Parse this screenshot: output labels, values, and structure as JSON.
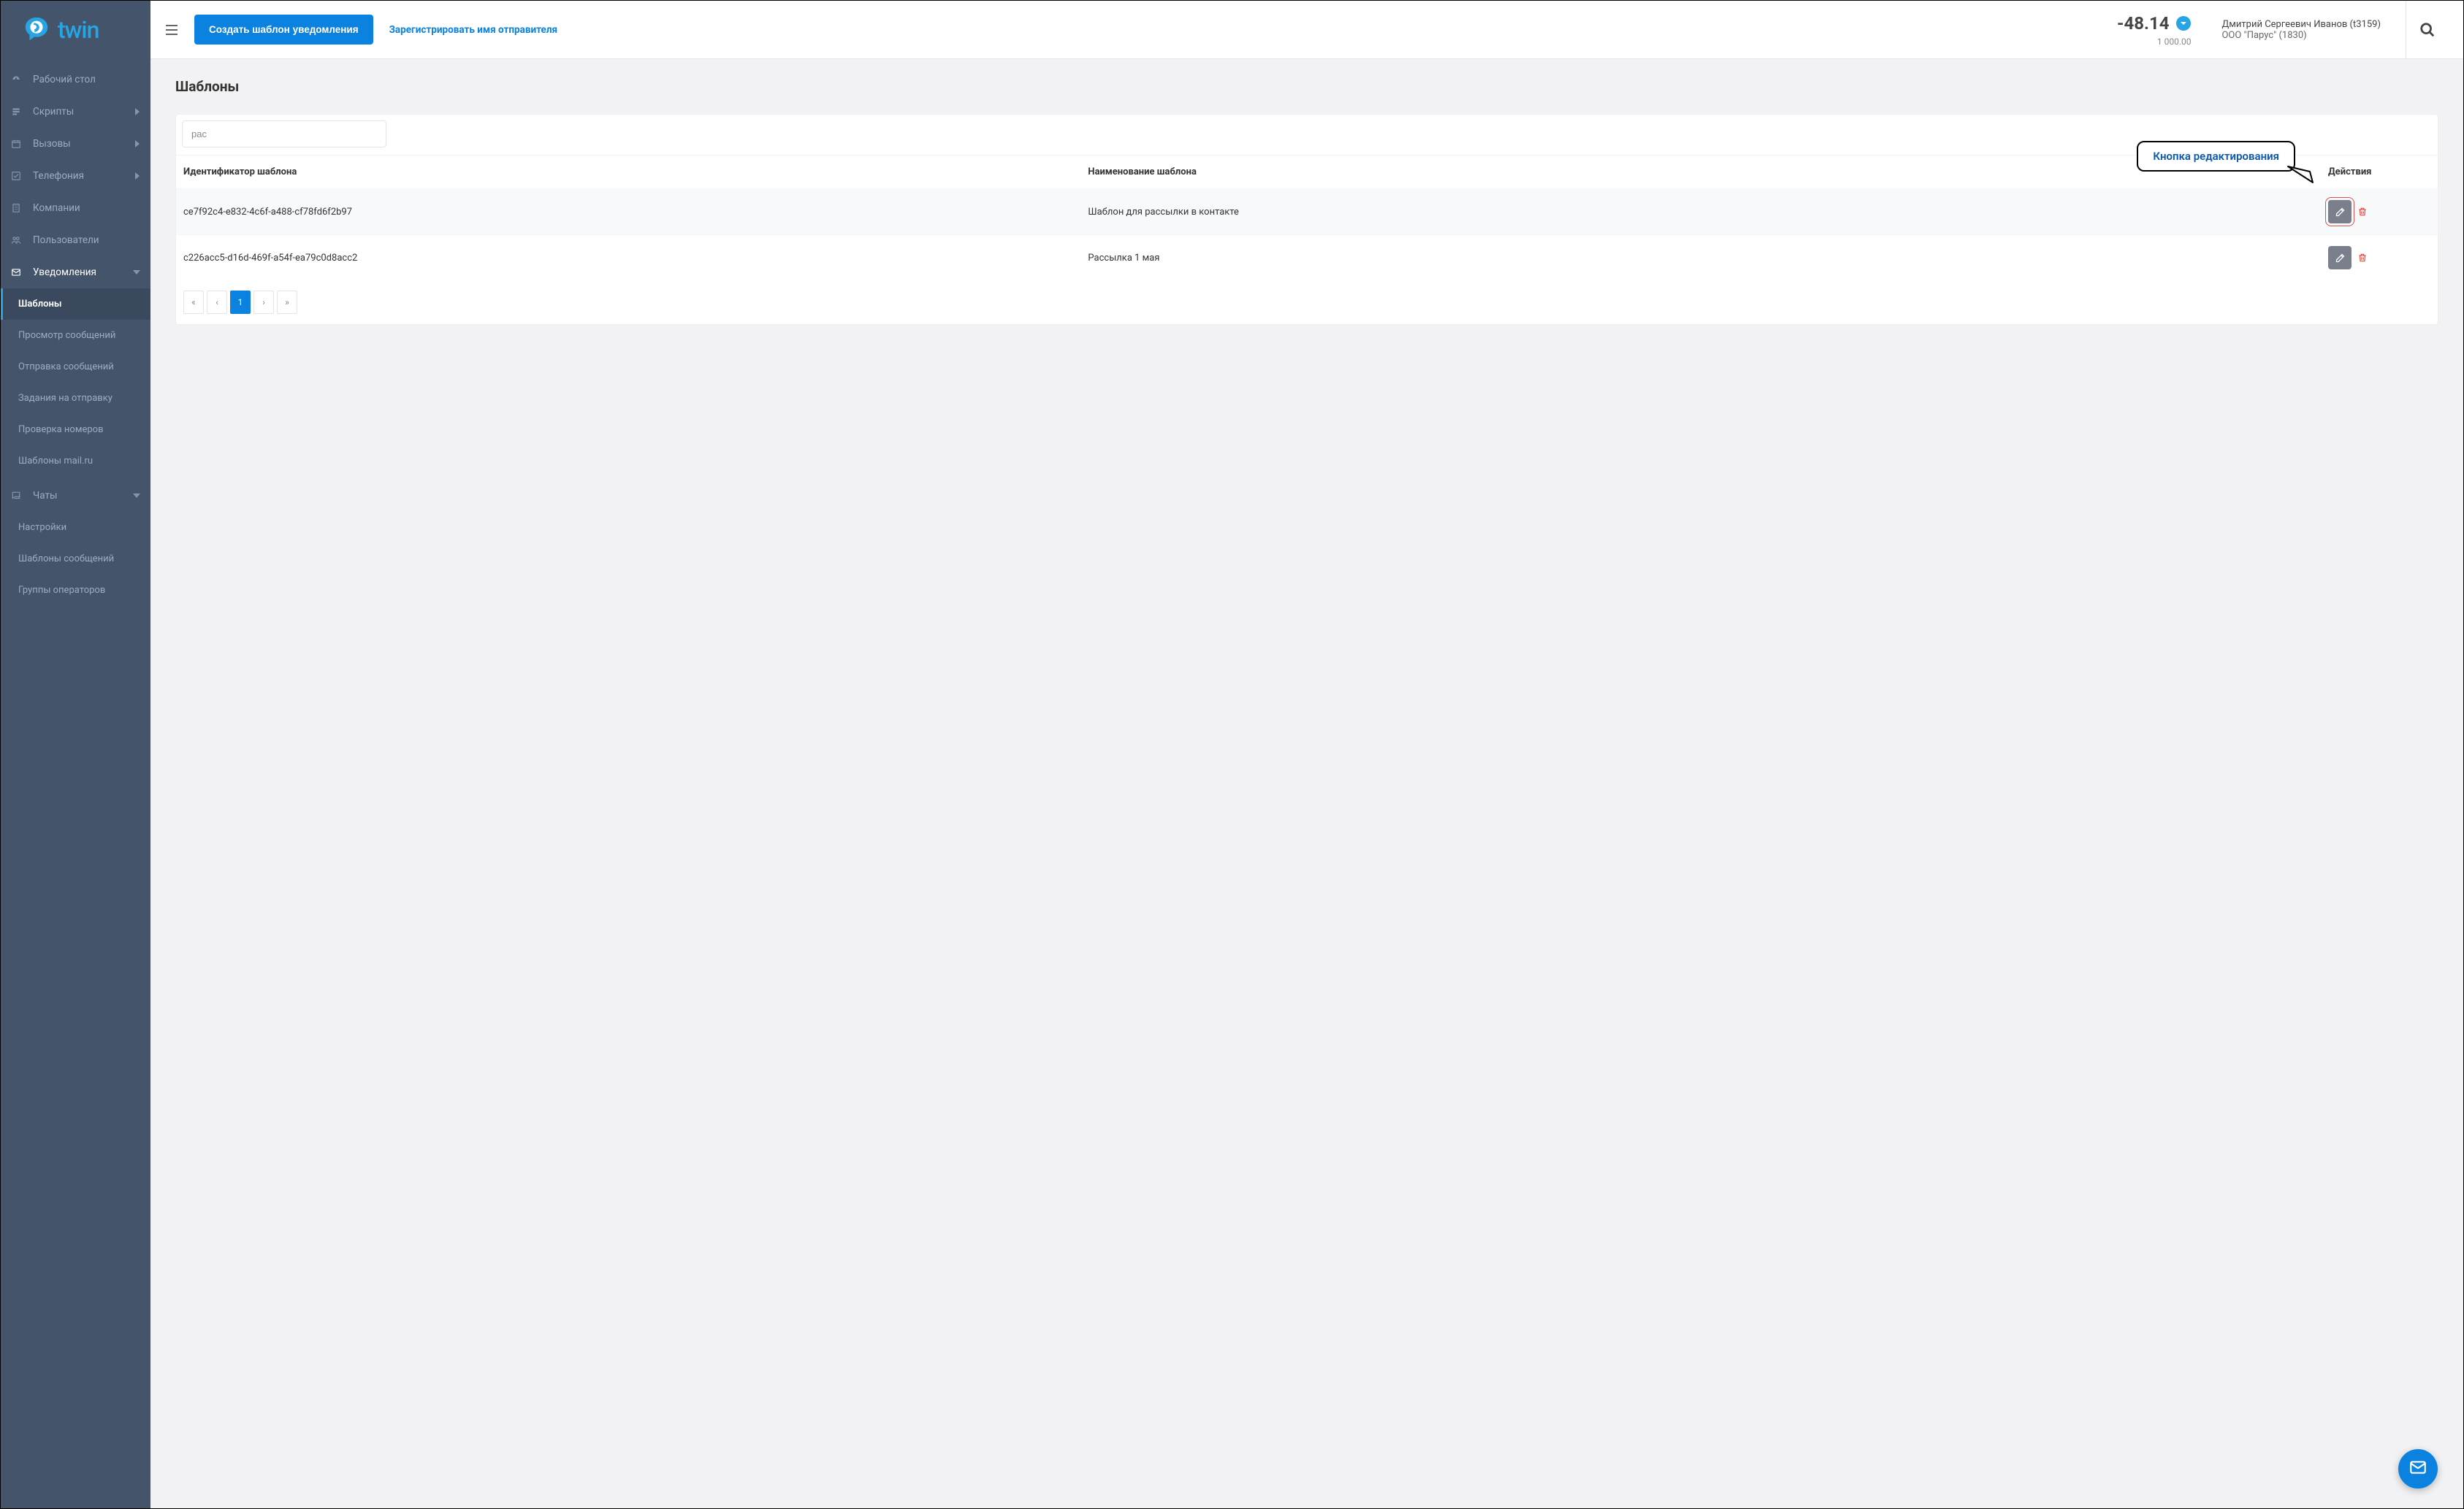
{
  "logo_text": "twin",
  "sidebar": {
    "items": [
      {
        "label": "Рабочий стол"
      },
      {
        "label": "Скрипты",
        "chevron": ">"
      },
      {
        "label": "Вызовы",
        "chevron": ">"
      },
      {
        "label": "Телефония",
        "chevron": ">"
      },
      {
        "label": "Компании"
      },
      {
        "label": "Пользователи"
      },
      {
        "label": "Уведомления",
        "chevron_down": true
      }
    ],
    "notifications_sub": [
      {
        "label": "Шаблоны",
        "active": true
      },
      {
        "label": "Просмотр сообщений"
      },
      {
        "label": "Отправка сообщений"
      },
      {
        "label": "Задания на отправку"
      },
      {
        "label": "Проверка номеров"
      },
      {
        "label": "Шаблоны mail.ru"
      }
    ],
    "chats": {
      "label": "Чаты"
    },
    "chats_sub": [
      {
        "label": "Настройки"
      },
      {
        "label": "Шаблоны сообщений"
      },
      {
        "label": "Группы операторов"
      }
    ]
  },
  "topbar": {
    "create_btn": "Создать шаблон уведомления",
    "register_link": "Зарегистрировать имя отправителя",
    "balance": "-48.14",
    "balance_sub": "1 000.00",
    "user_line1": "Дмитрий Сергеевич Иванов (t3159)",
    "user_line2": "ООО \"Парус\" (1830)"
  },
  "page": {
    "title": "Шаблоны",
    "filter_value": "рас",
    "columns": {
      "id": "Идентификатор шаблона",
      "name": "Наименование шаблона",
      "actions": "Действия"
    },
    "rows": [
      {
        "id": "ce7f92c4-e832-4c6f-a488-cf78fd6f2b97",
        "name": "Шаблон для рассылки в контакте",
        "highlight_edit": true
      },
      {
        "id": "c226acc5-d16d-469f-a54f-ea79c0d8acc2",
        "name": "Рассылка 1 мая"
      }
    ],
    "pagination": {
      "first": "«",
      "prev": "‹",
      "current": "1",
      "next": "›",
      "last": "»"
    }
  },
  "callout": {
    "text": "Кнопка редактирования"
  }
}
